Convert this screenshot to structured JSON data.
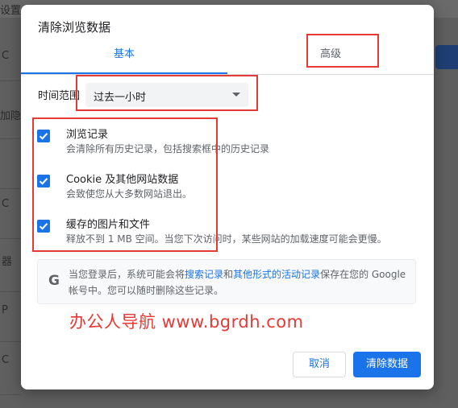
{
  "background": {
    "top_text": "设置",
    "side_text": "加隐",
    "side_marks": [
      "C",
      "C",
      "器",
      "P",
      "C"
    ]
  },
  "dialog": {
    "title": "清除浏览数据",
    "tabs": [
      {
        "label": "基本",
        "active": true
      },
      {
        "label": "高级",
        "active": false
      }
    ],
    "time_range": {
      "label": "时间范围",
      "selected": "过去一小时"
    },
    "options": [
      {
        "title": "浏览记录",
        "desc": "会清除所有历史记录，包括搜索框中的历史记录",
        "checked": true
      },
      {
        "title": "Cookie 及其他网站数据",
        "desc": "会致使您从大多数网站退出。",
        "checked": true
      },
      {
        "title": "缓存的图片和文件",
        "desc": "释放不到 1 MB 空间。当您下次访问时，某些网站的加载速度可能会更慢。",
        "checked": true
      }
    ],
    "info": {
      "icon": "G",
      "part1": "当您登录后，系统可能会将",
      "link1": "搜索记录",
      "part2": "和",
      "link2": "其他形式的活动记录",
      "part3": "保存在您的 Google 帐号中。您可以随时删除这些记录。"
    },
    "buttons": {
      "cancel": "取消",
      "clear": "清除数据"
    }
  },
  "watermark": "办公人导航  www.bgrdh.com",
  "colors": {
    "accent": "#1a73e8",
    "annotation_red": "#e53935",
    "overlay": "#5f5f5f"
  }
}
